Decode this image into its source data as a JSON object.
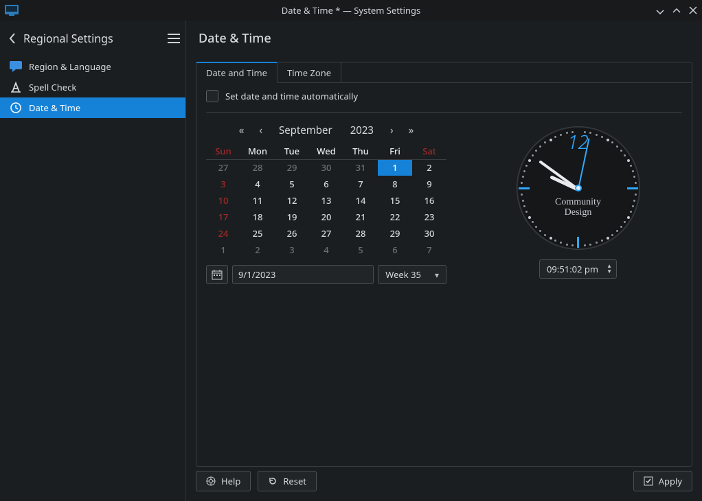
{
  "window": {
    "title": "Date & Time * — System Settings"
  },
  "sidebar": {
    "header": "Regional Settings",
    "items": [
      {
        "label": "Region & Language"
      },
      {
        "label": "Spell Check"
      },
      {
        "label": "Date & Time"
      }
    ]
  },
  "page": {
    "title": "Date & Time",
    "tabs": [
      {
        "label": "Date and Time"
      },
      {
        "label": "Time Zone"
      }
    ],
    "auto_checkbox_label": "Set date and time automatically",
    "calendar": {
      "month": "September",
      "year": "2023",
      "weekdays": [
        "Sun",
        "Mon",
        "Tue",
        "Wed",
        "Thu",
        "Fri",
        "Sat"
      ],
      "rows": [
        [
          {
            "d": "27",
            "t": "dim"
          },
          {
            "d": "28",
            "t": "dim"
          },
          {
            "d": "29",
            "t": "dim"
          },
          {
            "d": "30",
            "t": "dim"
          },
          {
            "d": "31",
            "t": "dim"
          },
          {
            "d": "1",
            "t": "sel"
          },
          {
            "d": "2",
            "t": "reg"
          }
        ],
        [
          {
            "d": "3",
            "t": "sun"
          },
          {
            "d": "4",
            "t": "reg"
          },
          {
            "d": "5",
            "t": "reg"
          },
          {
            "d": "6",
            "t": "reg"
          },
          {
            "d": "7",
            "t": "reg"
          },
          {
            "d": "8",
            "t": "reg"
          },
          {
            "d": "9",
            "t": "reg"
          }
        ],
        [
          {
            "d": "10",
            "t": "sun"
          },
          {
            "d": "11",
            "t": "reg"
          },
          {
            "d": "12",
            "t": "reg"
          },
          {
            "d": "13",
            "t": "reg"
          },
          {
            "d": "14",
            "t": "reg"
          },
          {
            "d": "15",
            "t": "reg"
          },
          {
            "d": "16",
            "t": "reg"
          }
        ],
        [
          {
            "d": "17",
            "t": "sun"
          },
          {
            "d": "18",
            "t": "reg"
          },
          {
            "d": "19",
            "t": "reg"
          },
          {
            "d": "20",
            "t": "reg"
          },
          {
            "d": "21",
            "t": "reg"
          },
          {
            "d": "22",
            "t": "reg"
          },
          {
            "d": "23",
            "t": "reg"
          }
        ],
        [
          {
            "d": "24",
            "t": "sun"
          },
          {
            "d": "25",
            "t": "reg"
          },
          {
            "d": "26",
            "t": "reg"
          },
          {
            "d": "27",
            "t": "reg"
          },
          {
            "d": "28",
            "t": "reg"
          },
          {
            "d": "29",
            "t": "reg"
          },
          {
            "d": "30",
            "t": "reg"
          }
        ],
        [
          {
            "d": "1",
            "t": "dim"
          },
          {
            "d": "2",
            "t": "dim"
          },
          {
            "d": "3",
            "t": "dim"
          },
          {
            "d": "4",
            "t": "dim"
          },
          {
            "d": "5",
            "t": "dim"
          },
          {
            "d": "6",
            "t": "dim"
          },
          {
            "d": "7",
            "t": "dim"
          }
        ]
      ],
      "date_input": "9/1/2023",
      "week_selector": "Week 35"
    },
    "clock": {
      "brand_line1": "Community",
      "brand_line2": "Design",
      "time_text": "09:51:02 pm",
      "hour_angle": 205,
      "minute_angle": 216,
      "second_angle": -78
    },
    "buttons": {
      "help": "Help",
      "reset": "Reset",
      "apply": "Apply"
    }
  }
}
